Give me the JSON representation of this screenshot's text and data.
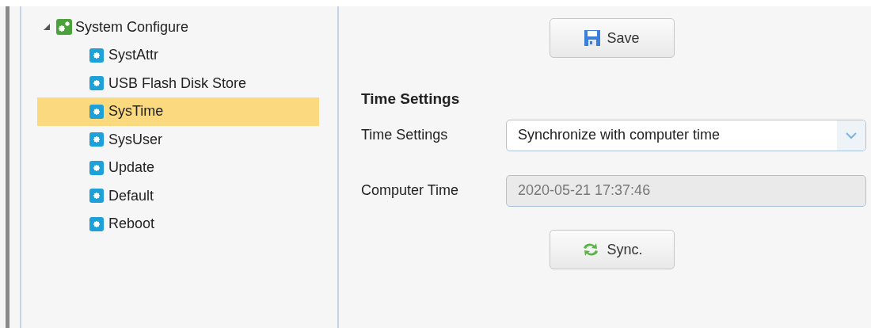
{
  "tree": {
    "label": "System Configure",
    "expanded": true,
    "children": [
      {
        "label": "SystAttr",
        "selected": false
      },
      {
        "label": "USB Flash Disk Store",
        "selected": false
      },
      {
        "label": "SysTime",
        "selected": true
      },
      {
        "label": "SysUser",
        "selected": false
      },
      {
        "label": "Update",
        "selected": false
      },
      {
        "label": "Default",
        "selected": false
      },
      {
        "label": "Reboot",
        "selected": false
      }
    ]
  },
  "save_button": {
    "label": "Save"
  },
  "section_title": "Time Settings",
  "fields": [
    {
      "kind": "select",
      "label": "Time Settings",
      "value": "Synchronize with computer time"
    },
    {
      "kind": "readonly",
      "label": "Computer Time",
      "value": "2020-05-21 17:37:46"
    }
  ],
  "sync_button": {
    "label": "Sync."
  }
}
